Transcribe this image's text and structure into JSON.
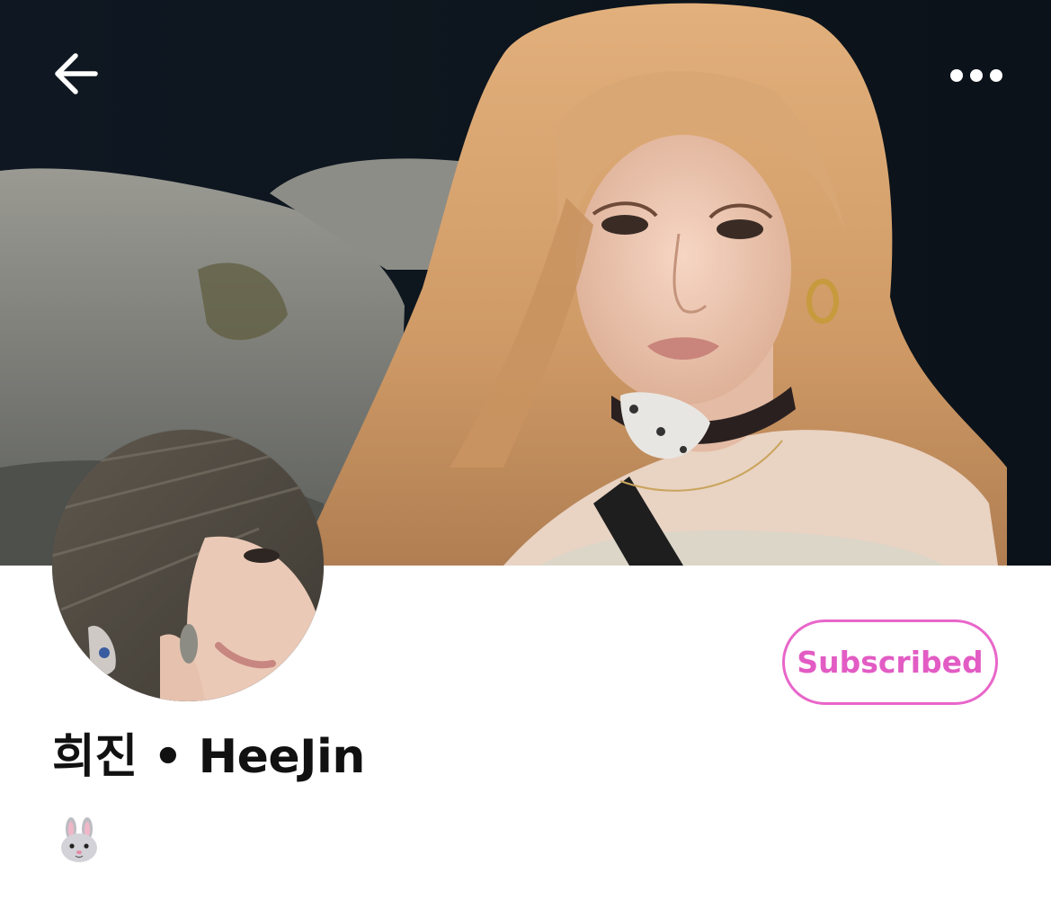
{
  "header": {
    "back_icon": "arrow-left-icon",
    "more_icon": "more-horizontal-icon",
    "icon_color": "#ffffff"
  },
  "profile": {
    "display_name": "희진 • HeeJin",
    "bio_emoji": "rabbit-face-icon",
    "subscribe_label": "Subscribed",
    "accent_color": "#e866c9"
  }
}
